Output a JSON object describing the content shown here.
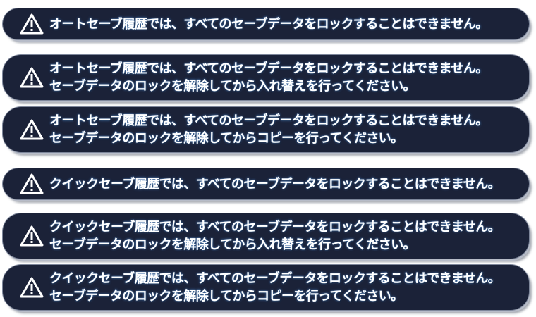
{
  "messages": [
    {
      "icon": "warning-icon",
      "lines": [
        "オートセーブ履歴では、すべてのセーブデータをロックすることはできません。"
      ]
    },
    {
      "icon": "warning-icon",
      "lines": [
        "オートセーブ履歴では、すべてのセーブデータをロックすることはできません。",
        "セーブデータのロックを解除してから入れ替えを行ってください。"
      ]
    },
    {
      "icon": "warning-icon",
      "lines": [
        "オートセーブ履歴では、すべてのセーブデータをロックすることはできません。",
        "セーブデータのロックを解除してからコピーを行ってください。"
      ]
    },
    {
      "icon": "warning-icon",
      "lines": [
        "クイックセーブ履歴では、すべてのセーブデータをロックすることはできません。"
      ]
    },
    {
      "icon": "warning-icon",
      "lines": [
        "クイックセーブ履歴では、すべてのセーブデータをロックすることはできません。",
        "セーブデータのロックを解除してから入れ替えを行ってください。"
      ]
    },
    {
      "icon": "warning-icon",
      "lines": [
        "クイックセーブ履歴では、すべてのセーブデータをロックすることはできません。",
        "セーブデータのロックを解除してからコピーを行ってください。"
      ]
    }
  ],
  "colors": {
    "banner_fill": "#1b2238",
    "banner_border": "#b7bcc8",
    "text": "#ffffff",
    "text_glow": "#3d6fae"
  }
}
